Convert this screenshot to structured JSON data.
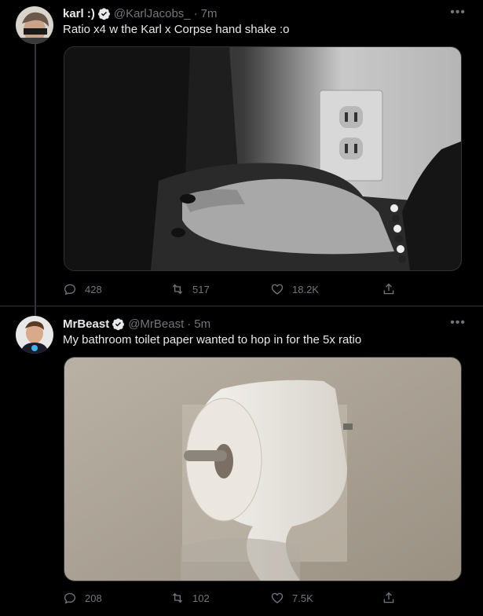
{
  "tweets": [
    {
      "name": "karl :)",
      "handle": "@KarlJacobs_",
      "dot": "·",
      "time": "7m",
      "verified": true,
      "text": "Ratio x4 w the Karl x Corpse hand shake :o",
      "media": "black-and-white photo of a hand with painted nails on a shoulder",
      "stats": {
        "replies": "428",
        "retweets": "517",
        "likes": "18.2K"
      }
    },
    {
      "name": "MrBeast",
      "handle": "@MrBeast",
      "dot": "·",
      "time": "5m",
      "verified": true,
      "text": "My bathroom toilet paper wanted to hop in for the 5x ratio",
      "media": "photo of a toilet paper roll on a wall holder",
      "stats": {
        "replies": "208",
        "retweets": "102",
        "likes": "7.5K"
      }
    }
  ],
  "icons": {
    "more": "more-horizontal-icon",
    "reply": "reply-icon",
    "retweet": "retweet-icon",
    "like": "heart-icon",
    "share": "share-icon",
    "verified": "verified-badge-icon"
  },
  "colors": {
    "background": "#000000",
    "text": "#e7e9ea",
    "secondary": "#71767b",
    "verified": "#1d9bf0"
  }
}
